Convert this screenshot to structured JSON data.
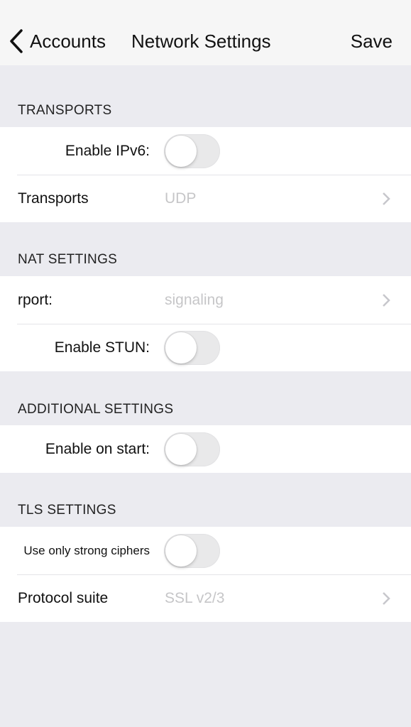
{
  "navbar": {
    "back_label": "Accounts",
    "title": "Network Settings",
    "save_label": "Save"
  },
  "sections": {
    "transports": {
      "header": "TRANSPORTS",
      "enable_ipv6": {
        "label": "Enable IPv6:",
        "on": false
      },
      "transports": {
        "label": "Transports",
        "value": "UDP"
      }
    },
    "nat": {
      "header": "NAT SETTINGS",
      "rport": {
        "label": "rport:",
        "value": "signaling"
      },
      "enable_stun": {
        "label": "Enable STUN:",
        "on": false
      }
    },
    "additional": {
      "header": "ADDITIONAL SETTINGS",
      "enable_on_start": {
        "label": "Enable on start:",
        "on": false
      }
    },
    "tls": {
      "header": "TLS SETTINGS",
      "strong_ciphers": {
        "label": "Use only strong ciphers",
        "on": false
      },
      "protocol_suite": {
        "label": "Protocol suite",
        "value": "SSL v2/3"
      }
    }
  }
}
